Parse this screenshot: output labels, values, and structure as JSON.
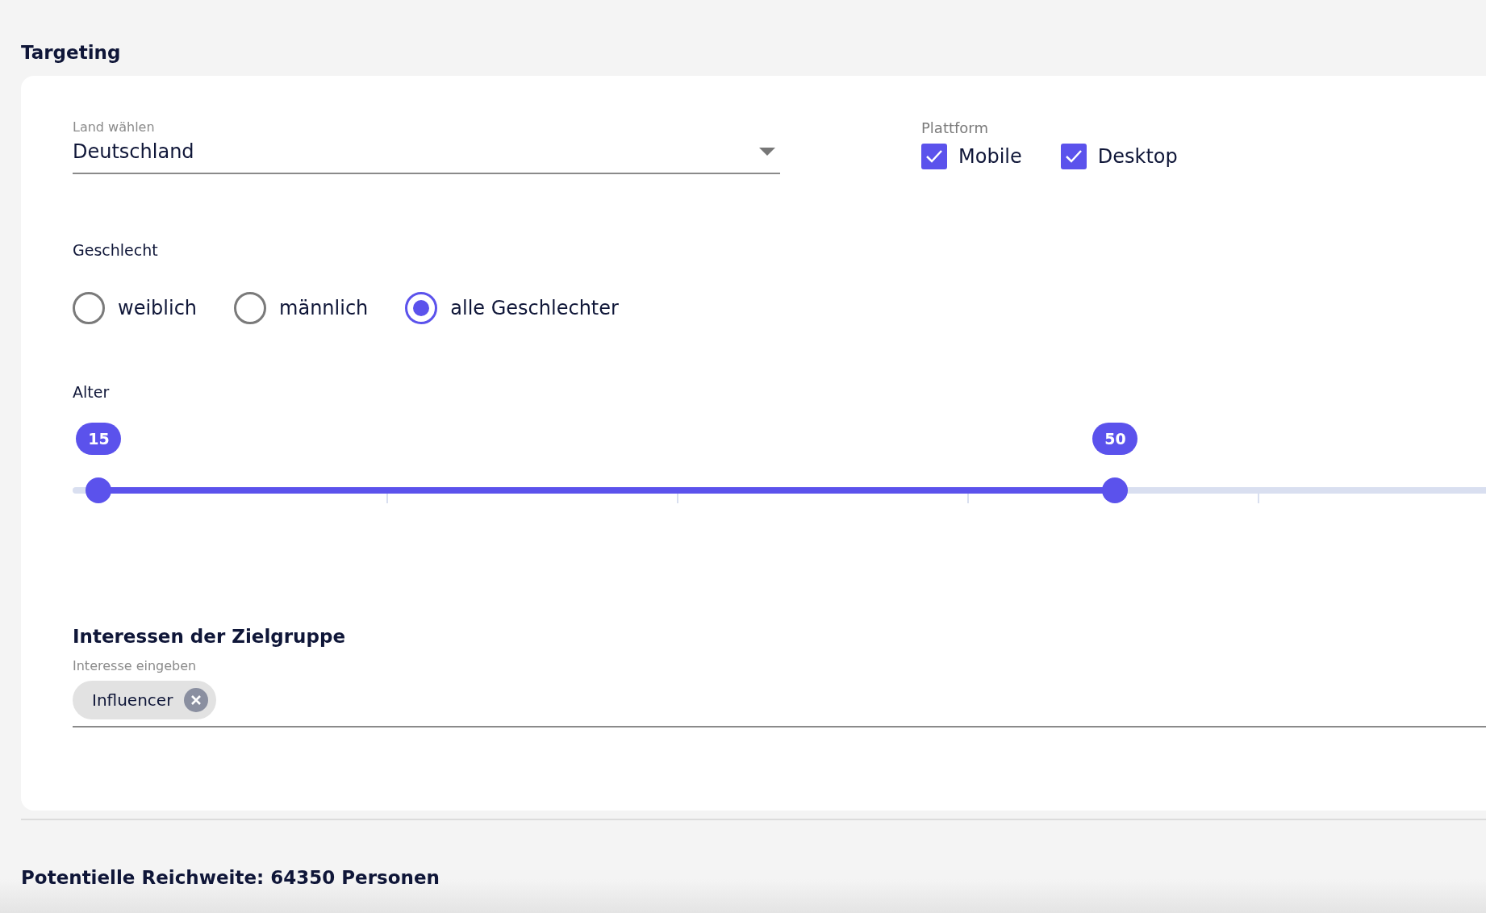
{
  "section_title": "Targeting",
  "country": {
    "label": "Land wählen",
    "value": "Deutschland"
  },
  "platform": {
    "label": "Plattform",
    "options": [
      {
        "label": "Mobile",
        "checked": true
      },
      {
        "label": "Desktop",
        "checked": true
      }
    ]
  },
  "gender": {
    "label": "Geschlecht",
    "options": [
      {
        "label": "weiblich",
        "selected": false
      },
      {
        "label": "männlich",
        "selected": false
      },
      {
        "label": "alle Geschlechter",
        "selected": true
      }
    ]
  },
  "age": {
    "label": "Alter",
    "thumbs": [
      {
        "value": "15",
        "level": 0.018
      },
      {
        "value": "50",
        "level": 0.718
      }
    ]
  },
  "interests": {
    "title": "Interessen der Zielgruppe",
    "label": "Interesse eingeben",
    "chips": [
      "Influencer"
    ]
  },
  "reach": "Potentielle Reichweite: 64350 Personen"
}
